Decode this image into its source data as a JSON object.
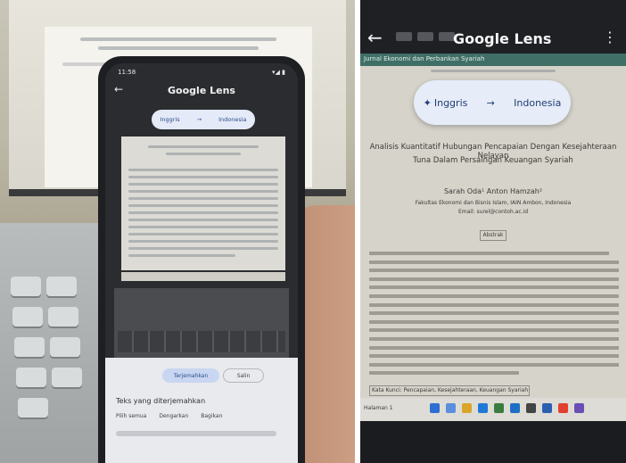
{
  "left_photo": {
    "phone": {
      "status_time": "11:58",
      "status_signal": "▾◢ ▮",
      "app_title": "Google Lens",
      "source_lang": "Inggris",
      "target_lang": "Indonesia",
      "translate_button": "Terjemahkan",
      "copy_button": "Salin",
      "sheet_title": "Teks yang diterjemahkan",
      "options": [
        "Pilih semua",
        "Dengarkan",
        "Bagikan"
      ]
    }
  },
  "right_photo": {
    "app_title": "Google Lens",
    "source_lang": "Inggris",
    "target_lang": "Indonesia",
    "menu_label": "Jurnal Ekonomi dan Perbankan Syariah",
    "paper_title_line1": "Analisis Kuantitatif Hubungan Pencapaian Dengan Kesejahteraan Nelayan",
    "paper_title_line2": "Tuna Dalam Persaingan Keuangan Syariah",
    "authors": "Sarah Oda¹ Anton Hamzah²",
    "affiliation": "Fakultas Ekonomi dan Bisnis Islam, IAIN Ambon, Indonesia",
    "email": "Email: surel@contoh.ac.id",
    "abstract_label": "Abstrak",
    "keywords": "Kata Kunci: Pencapaian, Kesejahteraan, Keuangan Syariah",
    "taskbar_label": "Halaman 1",
    "colors": {
      "teal_bar": "#3f6f66",
      "lang_chip_bg": "#e6ecf8",
      "lang_text": "#1f3d73"
    }
  }
}
